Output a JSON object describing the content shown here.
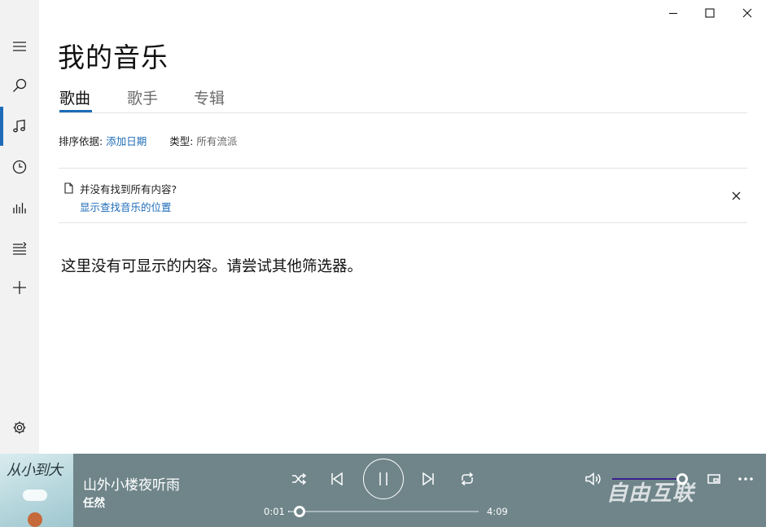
{
  "sidebar": {
    "items": [
      {
        "name": "menu",
        "icon": "hamburger-icon"
      },
      {
        "name": "search",
        "icon": "search-icon"
      },
      {
        "name": "my-music",
        "icon": "music-note-icon",
        "active": true
      },
      {
        "name": "recent",
        "icon": "clock-icon"
      },
      {
        "name": "now-playing",
        "icon": "equalizer-icon"
      },
      {
        "name": "playlists",
        "icon": "playlist-icon"
      },
      {
        "name": "new-playlist",
        "icon": "plus-icon"
      },
      {
        "name": "settings",
        "icon": "gear-icon"
      }
    ]
  },
  "window": {
    "controls": [
      "minimize-icon",
      "maximize-icon",
      "close-icon"
    ]
  },
  "page": {
    "title": "我的音乐",
    "tabs": [
      {
        "label": "歌曲",
        "active": true
      },
      {
        "label": "歌手",
        "active": false
      },
      {
        "label": "专辑",
        "active": false
      }
    ]
  },
  "filter": {
    "sort_label": "排序依据:",
    "sort_value": "添加日期",
    "type_label": "类型:",
    "type_value": "所有流派"
  },
  "notice": {
    "question": "并没有找到所有内容?",
    "link": "显示查找音乐的位置"
  },
  "empty_message": "这里没有可显示的内容。请尝试其他筛选器。",
  "player": {
    "song_title": "山外小楼夜听雨",
    "artist": "任然",
    "elapsed": "0:01",
    "duration": "4:09",
    "progress_fraction": 0.004,
    "volume_fraction": 1.0,
    "accent_color": "#6f858a",
    "watermark": "自由互联"
  },
  "colors": {
    "accent": "#1e6cb8",
    "player_bg": "#6f858a",
    "sidebar_bg": "#f2f2f2"
  }
}
